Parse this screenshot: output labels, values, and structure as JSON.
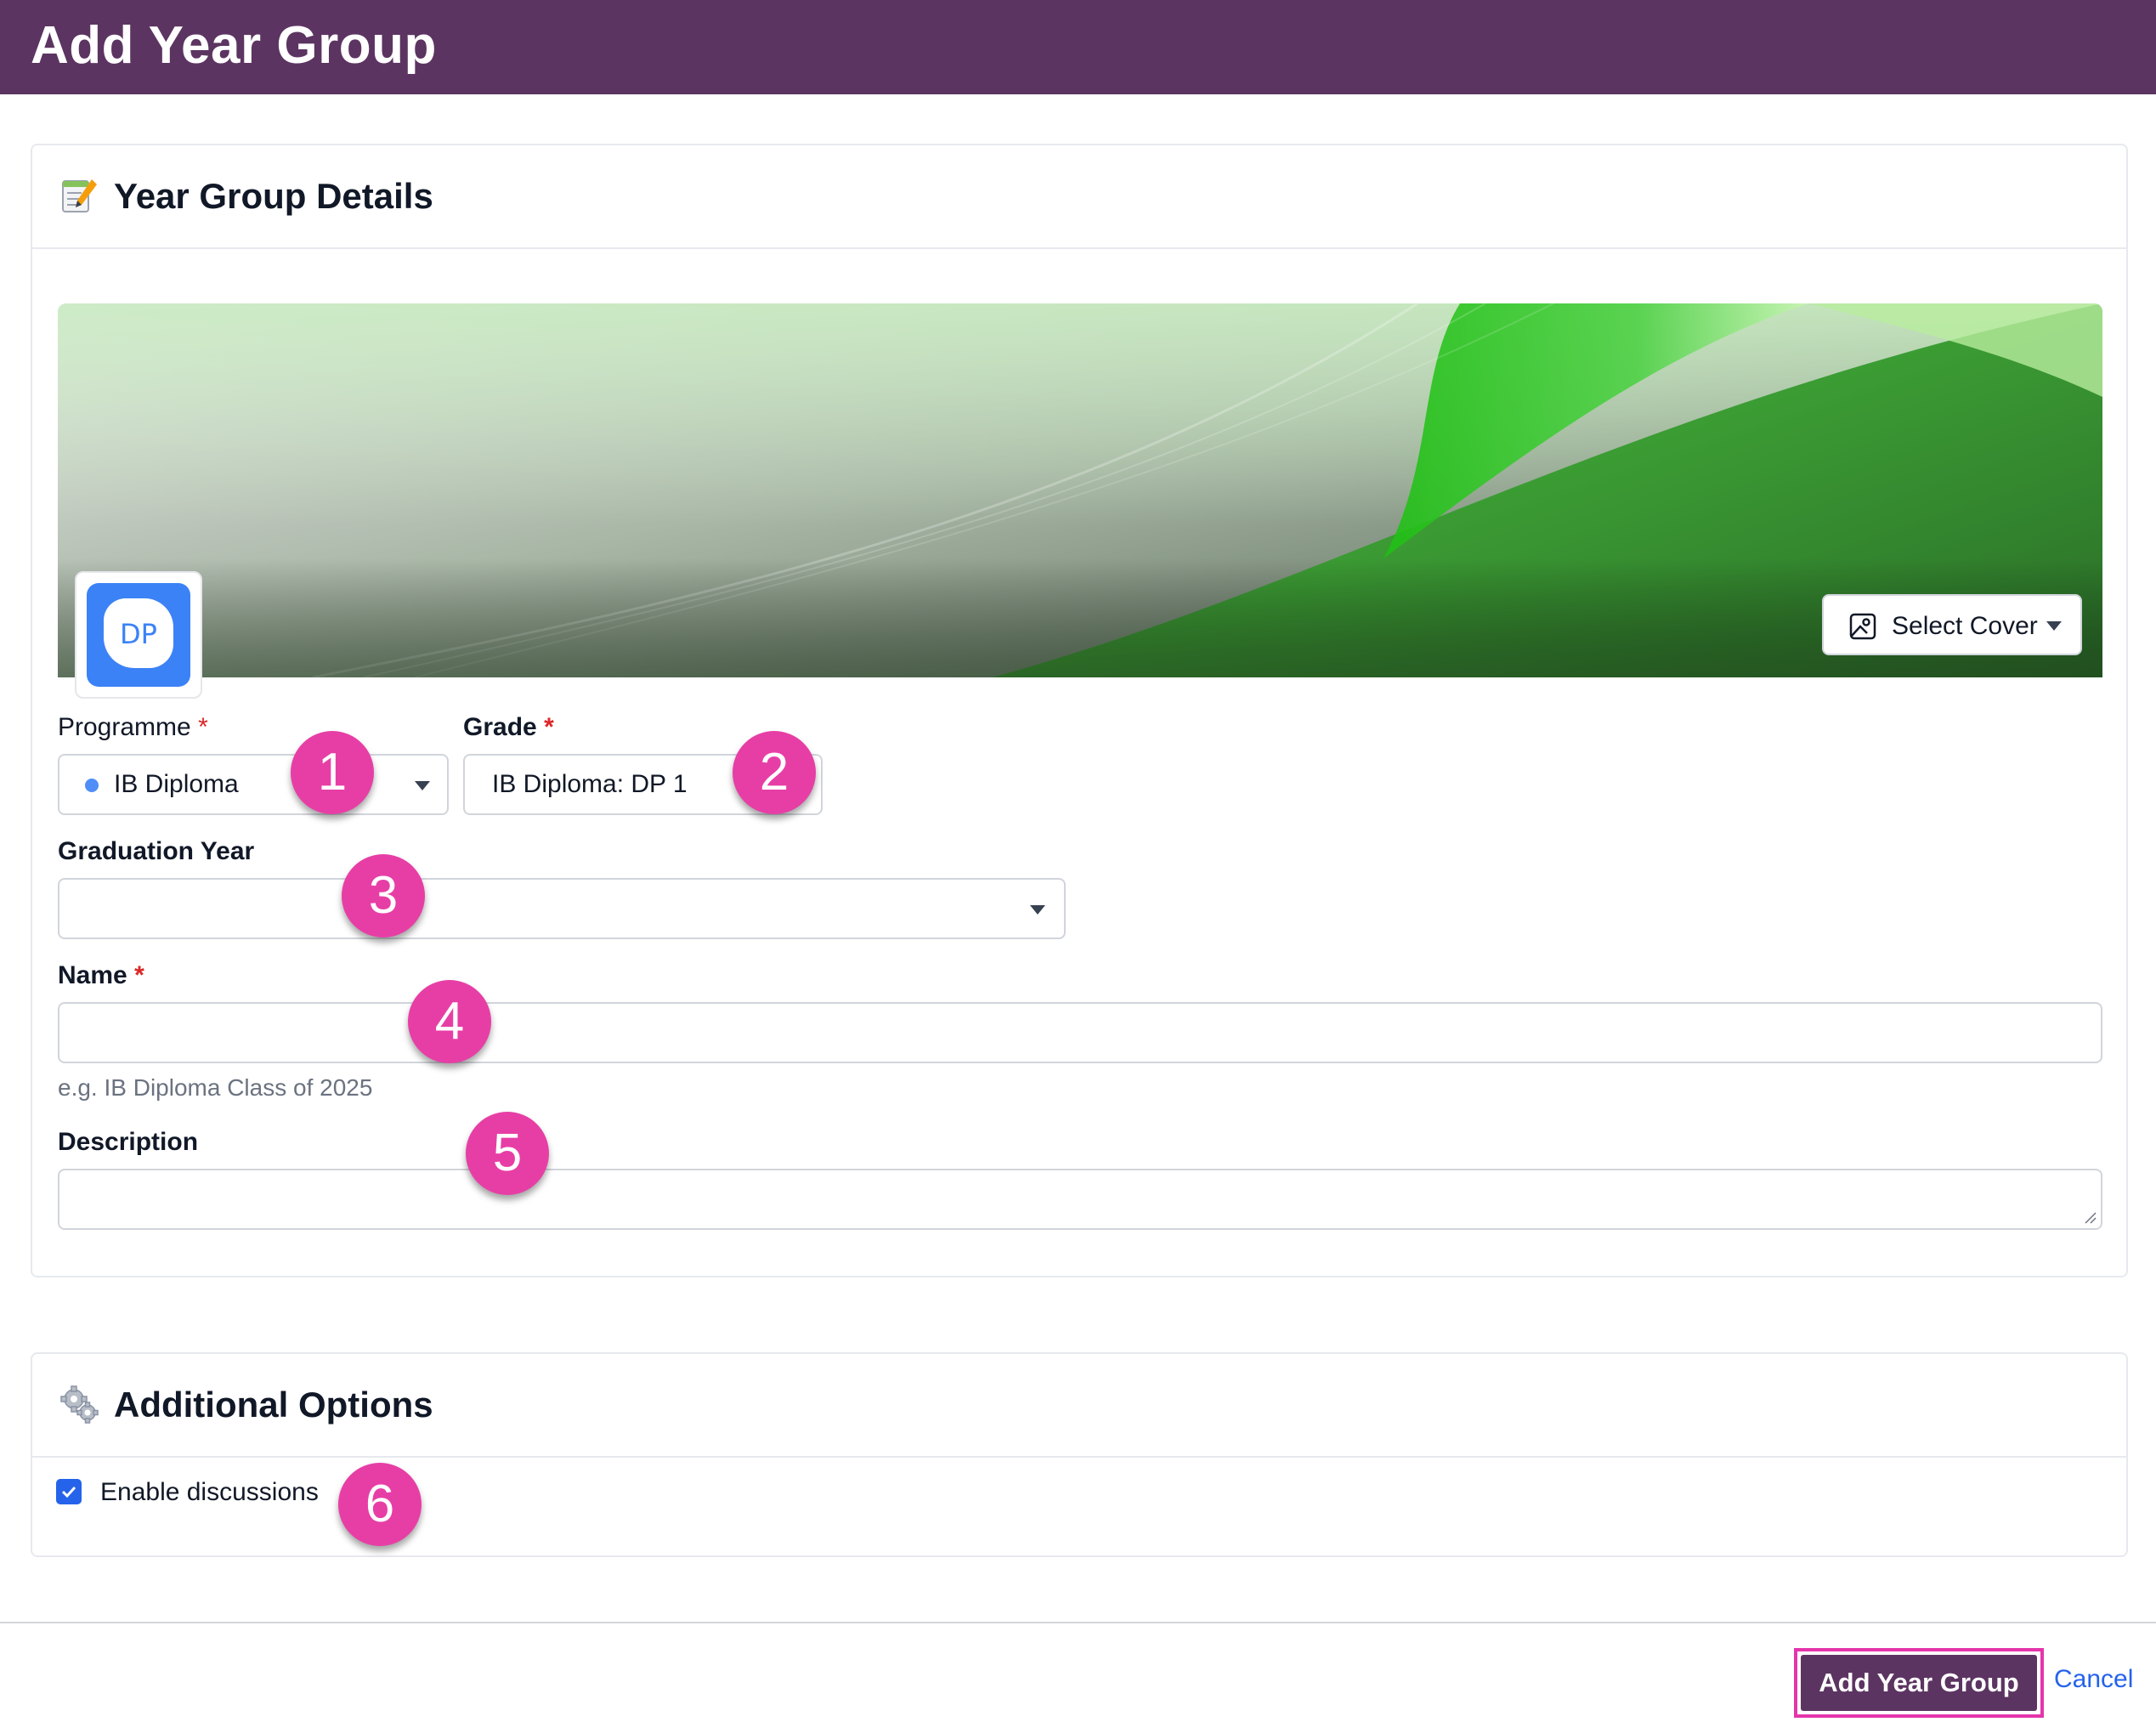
{
  "header": {
    "title": "Add Year Group"
  },
  "details": {
    "title": "Year Group Details",
    "icon": "memo-pencil-icon",
    "cover": {
      "select_cover_label": "Select Cover",
      "logo_text": "DP"
    },
    "programme": {
      "label": "Programme",
      "required_mark": "*",
      "value": "IB Diploma",
      "dot_color": "#4f8ef7"
    },
    "grade": {
      "label": "Grade",
      "required_mark": "*",
      "value": "IB Diploma: DP 1"
    },
    "graduation_year": {
      "label": "Graduation Year",
      "value": ""
    },
    "name": {
      "label": "Name",
      "required_mark": "*",
      "value": "",
      "hint": "e.g. IB Diploma Class of 2025"
    },
    "description": {
      "label": "Description",
      "value": ""
    }
  },
  "options": {
    "title": "Additional Options",
    "icon": "gears-icon",
    "enable_discussions": {
      "label": "Enable discussions",
      "checked": true
    }
  },
  "callouts": [
    "1",
    "2",
    "3",
    "4",
    "5",
    "6"
  ],
  "footer": {
    "submit_label": "Add Year Group",
    "cancel_label": "Cancel"
  },
  "colors": {
    "brand": "#5c3461",
    "callout": "#e73ea6",
    "link": "#2563eb",
    "highlight": "#e535ab"
  }
}
